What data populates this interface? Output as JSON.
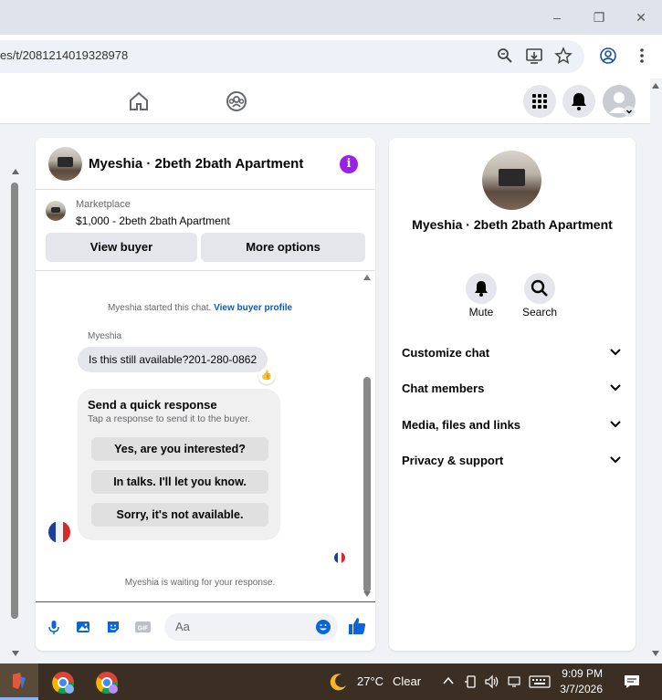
{
  "browser": {
    "url": "es/t/2081214019328978",
    "minimize": "–",
    "restore": "❐",
    "close": "✕"
  },
  "chat": {
    "title": "Myeshia · 2beth 2bath Apartment",
    "info_glyph": "i",
    "marketplace_label": "Marketplace",
    "listing": "$1,000 - 2beth 2bath Apartment",
    "view_buyer": "View buyer",
    "more_options": "More options",
    "started_text": "Myeshia started this chat.",
    "view_profile": "View buyer profile",
    "sender": "Myeshia",
    "message": "Is this still available?201-280-0862",
    "reaction": "👍",
    "quick_title": "Send a quick response",
    "quick_subtitle": "Tap a response to send it to the buyer.",
    "quick_options": [
      "Yes, are you interested?",
      "In talks. I'll let you know.",
      "Sorry, it's not available."
    ],
    "waiting": "Myeshia is waiting for your response.",
    "composer_placeholder": "Aa",
    "gif_label": "GIF"
  },
  "details": {
    "title": "Myeshia · 2beth 2bath Apartment",
    "actions": [
      {
        "label": "Mute"
      },
      {
        "label": "Search"
      }
    ],
    "sections": [
      "Customize chat",
      "Chat members",
      "Media, files and links",
      "Privacy & support"
    ]
  },
  "taskbar": {
    "weather_temp": "27°C",
    "weather_cond": "Clear",
    "time": "9:09 PM",
    "date": "3/7/2026"
  },
  "colors": {
    "accent": "#0a66d8",
    "info": "#9b1fe8"
  }
}
